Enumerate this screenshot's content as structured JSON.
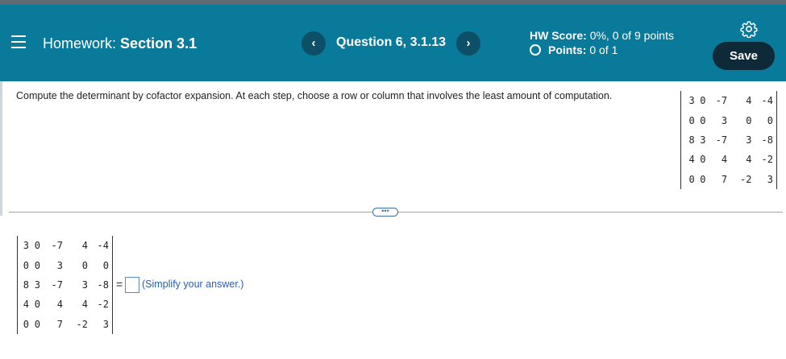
{
  "header": {
    "hw_label": "Homework:",
    "section": "Section 3.1",
    "prev_symbol": "‹",
    "next_symbol": "›",
    "question": "Question 6, 3.1.13",
    "score_label": "HW Score:",
    "score_value": "0%, 0 of 9 points",
    "points_label": "Points:",
    "points_value": "0 of 1",
    "save_label": "Save",
    "colors": {
      "header_bg": "#097a9a",
      "save_bg": "#0e2a38"
    }
  },
  "problem": {
    "prompt": "Compute the determinant by cofactor expansion. At each step, choose a row or column that involves the least amount of computation.",
    "matrix": [
      [
        "3",
        "0",
        "-7",
        "4",
        "-4"
      ],
      [
        "0",
        "0",
        "3",
        "0",
        "0"
      ],
      [
        "8",
        "3",
        "-7",
        "3",
        "-8"
      ],
      [
        "4",
        "0",
        "4",
        "4",
        "-2"
      ],
      [
        "0",
        "0",
        "7",
        "-2",
        "3"
      ]
    ]
  },
  "answer": {
    "equals": "=",
    "value": "",
    "hint": "(Simplify your answer.)"
  },
  "divider_handle": "•••"
}
